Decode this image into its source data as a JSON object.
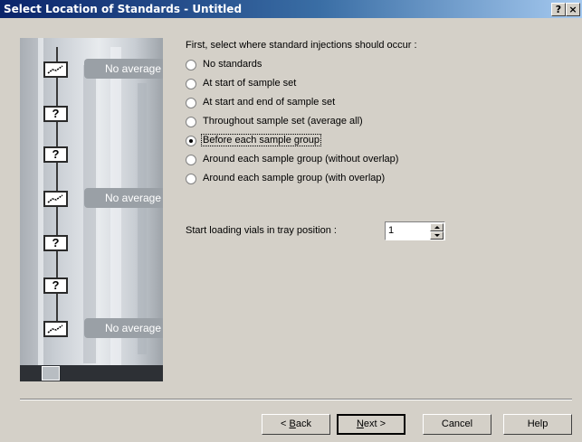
{
  "window": {
    "title": "Select Location of Standards - Untitled",
    "help_button": "?",
    "close_button": "×"
  },
  "graphic": {
    "items": [
      {
        "kind": "standard",
        "label": "No average"
      },
      {
        "kind": "unknown",
        "label": "?"
      },
      {
        "kind": "unknown",
        "label": "?"
      },
      {
        "kind": "standard",
        "label": "No average"
      },
      {
        "kind": "unknown",
        "label": "?"
      },
      {
        "kind": "unknown",
        "label": "?"
      },
      {
        "kind": "standard",
        "label": "No average"
      }
    ]
  },
  "prompt": "First, select where standard injections should occur :",
  "options": [
    {
      "label": "No standards",
      "selected": false
    },
    {
      "label": "At start of sample set",
      "selected": false
    },
    {
      "label": "At start and end of sample set",
      "selected": false
    },
    {
      "label": "Throughout sample set (average all)",
      "selected": false
    },
    {
      "label": "Before each sample group",
      "selected": true
    },
    {
      "label": "Around each sample group (without overlap)",
      "selected": false
    },
    {
      "label": "Around each sample group (with overlap)",
      "selected": false
    }
  ],
  "tray": {
    "label": "Start loading vials in tray position :",
    "value": "1"
  },
  "buttons": {
    "back": {
      "accel": "B",
      "rest": "ack",
      "prefix": "< "
    },
    "next": {
      "accel": "N",
      "rest": "ext >"
    },
    "cancel": "Cancel",
    "help": "Help"
  }
}
